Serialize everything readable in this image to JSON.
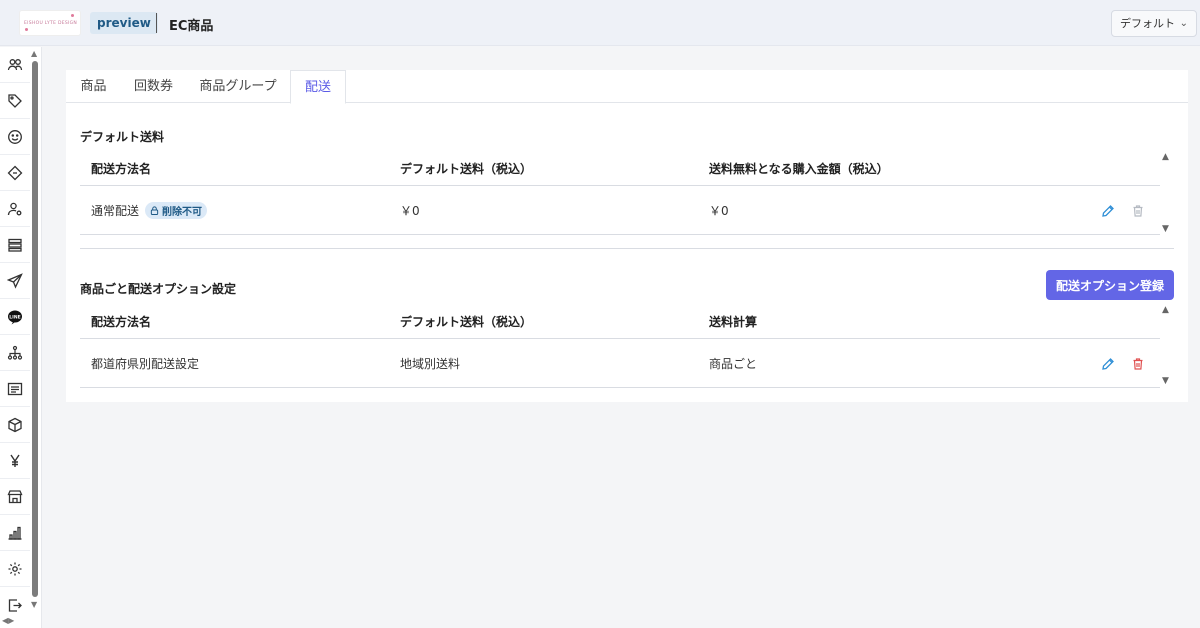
{
  "header": {
    "logo_text": "EISHOU LYTE DESIGN",
    "preview_label": "preview",
    "page_title": "EC商品",
    "default_select": "デフォルト"
  },
  "sidebar": {
    "icons": [
      "users-icon",
      "tag-icon",
      "smile-icon",
      "ticket-icon",
      "user-settings-icon",
      "list-icon",
      "send-icon",
      "line-icon",
      "org-chart-icon",
      "document-icon",
      "box-icon",
      "yen-icon",
      "store-icon",
      "bar-chart-icon",
      "gear-icon",
      "export-icon"
    ]
  },
  "tabs": [
    {
      "label": "商品"
    },
    {
      "label": "回数券"
    },
    {
      "label": "商品グループ"
    },
    {
      "label": "配送",
      "active": true
    }
  ],
  "default_shipping": {
    "title": "デフォルト送料",
    "columns": [
      "配送方法名",
      "デフォルト送料（税込）",
      "送料無料となる購入金額（税込）"
    ],
    "rows": [
      {
        "name": "通常配送",
        "badge": "削除不可",
        "fee": "￥0",
        "free_threshold": "￥0"
      }
    ]
  },
  "option_shipping": {
    "title": "商品ごと配送オプション設定",
    "register_button": "配送オプション登録",
    "columns": [
      "配送方法名",
      "デフォルト送料（税込）",
      "送料計算"
    ],
    "rows": [
      {
        "name": "都道府県別配送設定",
        "fee": "地域別送料",
        "calc": "商品ごと"
      }
    ]
  },
  "colors": {
    "accent": "#6366e6",
    "edit_icon": "#2f8fd6",
    "delete_icon_active": "#e05050",
    "delete_icon_disabled": "#b5bac2"
  }
}
